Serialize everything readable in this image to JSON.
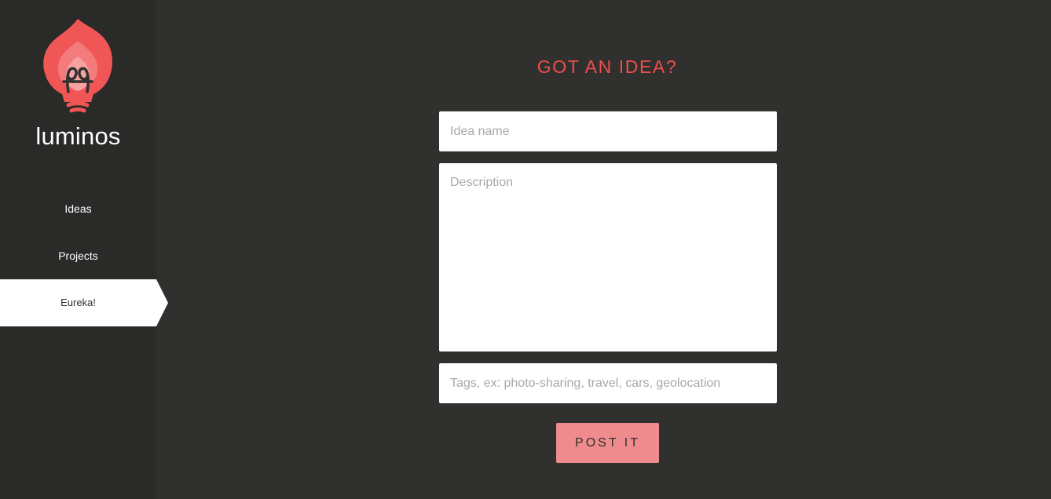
{
  "app": {
    "brand": "luminos",
    "logo_icon": "lightbulb-flame-icon",
    "colors": {
      "background": "#30302e",
      "sidebar": "#2a2a28",
      "accent": "#ef4e4c",
      "button": "#ef8b8c"
    }
  },
  "sidebar": {
    "items": [
      {
        "label": "Ideas",
        "active": false
      },
      {
        "label": "Projects",
        "active": false
      },
      {
        "label": "Eureka!",
        "active": true
      }
    ]
  },
  "form": {
    "title": "GOT AN IDEA?",
    "idea_name": {
      "value": "",
      "placeholder": "Idea name"
    },
    "description": {
      "value": "",
      "placeholder": "Description"
    },
    "tags": {
      "value": "",
      "placeholder": "Tags, ex: photo-sharing, travel, cars, geolocation"
    },
    "submit_label": "POST IT"
  }
}
